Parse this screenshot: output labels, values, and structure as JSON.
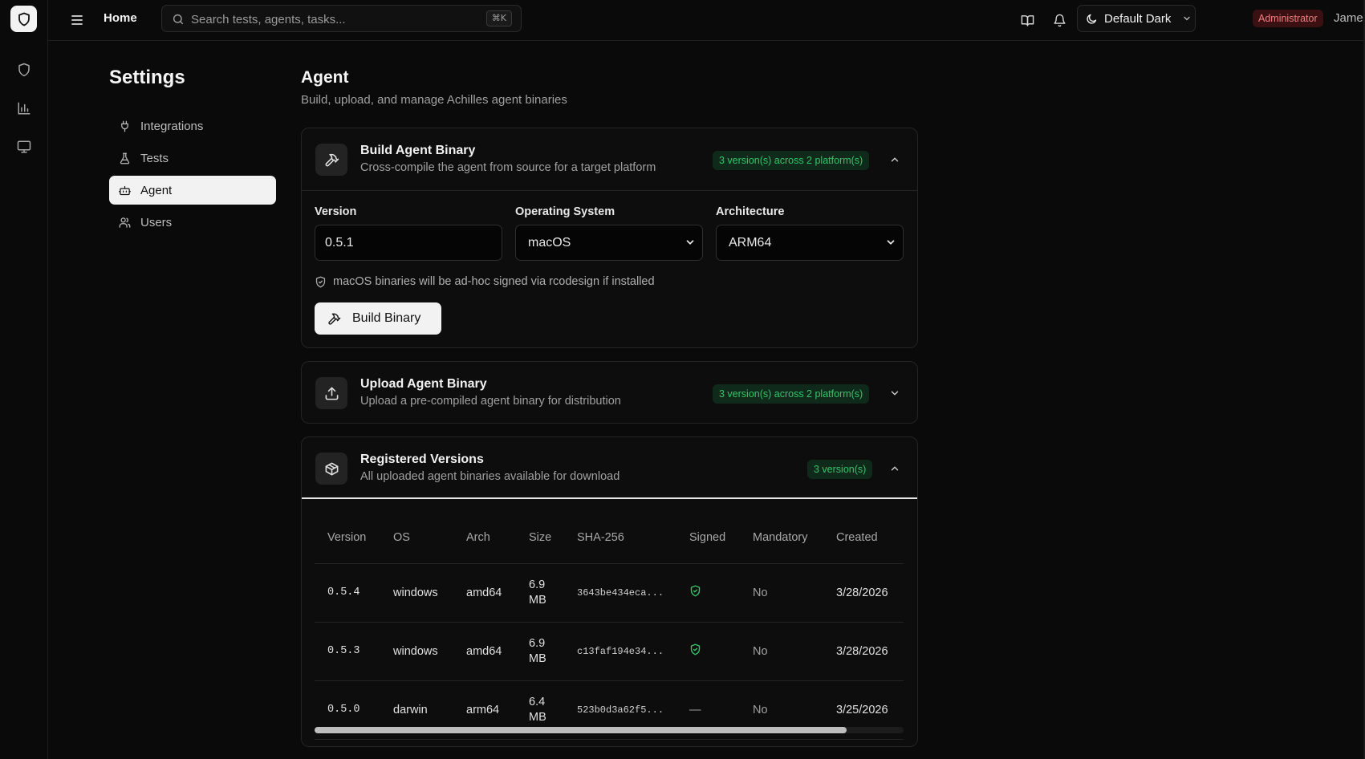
{
  "topbar": {
    "home_label": "Home",
    "search_placeholder": "Search tests, agents, tasks...",
    "search_shortcut": "⌘K",
    "theme_label": "Default Dark",
    "role_badge": "Administrator",
    "user_name": "James"
  },
  "rail": {
    "icons": [
      "shield-icon",
      "bar-chart-icon",
      "monitor-icon"
    ]
  },
  "settings": {
    "title": "Settings",
    "nav": [
      {
        "label": "Integrations",
        "icon": "plug-icon",
        "active": false
      },
      {
        "label": "Tests",
        "icon": "flask-icon",
        "active": false
      },
      {
        "label": "Agent",
        "icon": "bot-icon",
        "active": true
      },
      {
        "label": "Users",
        "icon": "users-icon",
        "active": false
      }
    ]
  },
  "page": {
    "title": "Agent",
    "subtitle": "Build, upload, and manage Achilles agent binaries"
  },
  "build_card": {
    "title": "Build Agent Binary",
    "description": "Cross-compile the agent from source for a target platform",
    "badge": "3 version(s) across 2 platform(s)",
    "expanded": true,
    "version_label": "Version",
    "version_value": "0.5.1",
    "os_label": "Operating System",
    "os_value": "macOS",
    "arch_label": "Architecture",
    "arch_value": "ARM64",
    "hint": "macOS binaries will be ad-hoc signed via rcodesign if installed",
    "button_label": "Build Binary"
  },
  "upload_card": {
    "title": "Upload Agent Binary",
    "description": "Upload a pre-compiled agent binary for distribution",
    "badge": "3 version(s) across 2 platform(s)",
    "expanded": false
  },
  "versions_card": {
    "title": "Registered Versions",
    "description": "All uploaded agent binaries available for download",
    "badge": "3 version(s)",
    "expanded": true,
    "columns": [
      "Version",
      "OS",
      "Arch",
      "Size",
      "SHA-256",
      "Signed",
      "Mandatory",
      "Created"
    ],
    "rows": [
      {
        "version": "0.5.4",
        "os": "windows",
        "arch": "amd64",
        "size": "6.9 MB",
        "sha": "3643be434eca...",
        "signed": true,
        "mandatory": "No",
        "created": "3/28/2026"
      },
      {
        "version": "0.5.3",
        "os": "windows",
        "arch": "amd64",
        "size": "6.9 MB",
        "sha": "c13faf194e34...",
        "signed": true,
        "mandatory": "No",
        "created": "3/28/2026"
      },
      {
        "version": "0.5.0",
        "os": "darwin",
        "arch": "arm64",
        "size": "6.4 MB",
        "sha": "523b0d3a62f5...",
        "signed": false,
        "signed_text": "—",
        "mandatory": "No",
        "created": "3/25/2026"
      }
    ]
  },
  "colors": {
    "accent_green": "#34c46a",
    "danger": "#f08080",
    "background": "#0a0a0a"
  }
}
